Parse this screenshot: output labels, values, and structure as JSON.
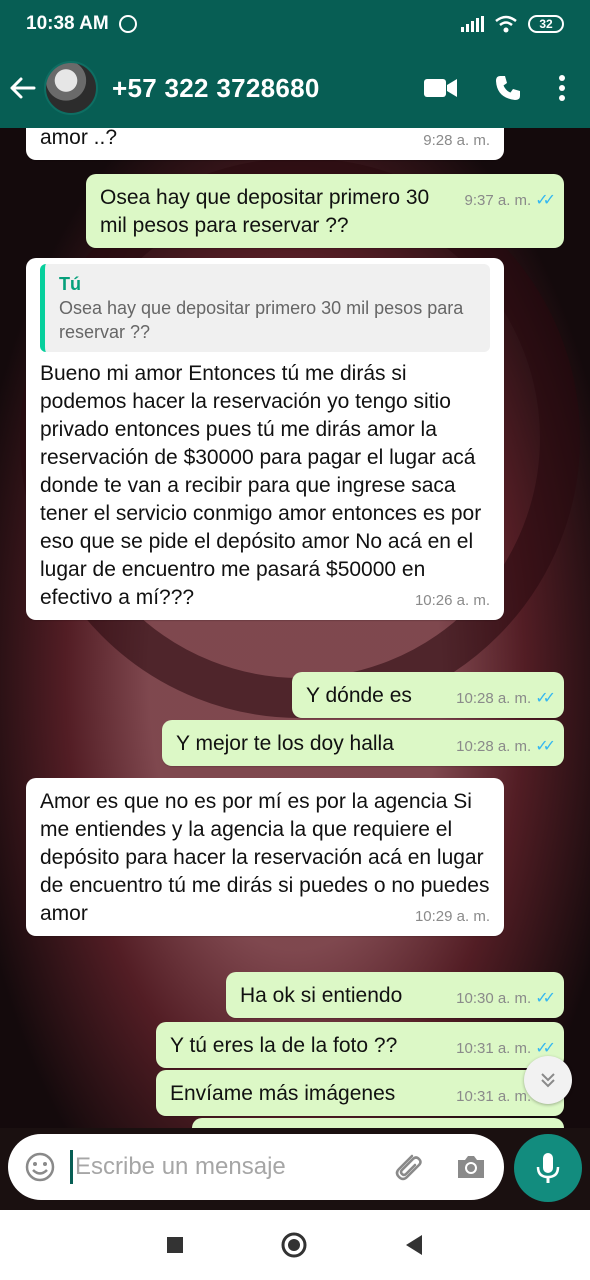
{
  "status": {
    "time": "10:38 AM",
    "battery": "32"
  },
  "header": {
    "contact": "+57 322 3728680"
  },
  "messages": [
    {
      "dir": "in",
      "text": "amor ..?",
      "time": "9:28 a. m."
    },
    {
      "dir": "out",
      "text": "Osea hay que depositar primero 30 mil pesos para reservar ??",
      "time": "9:37 a. m."
    },
    {
      "dir": "in",
      "quote_author": "Tú",
      "quote_text": "Osea hay que depositar primero 30 mil pesos para reservar ??",
      "text": "Bueno mi amor Entonces tú me dirás si podemos hacer la reservación yo tengo sitio privado entonces pues tú me dirás amor la reservación de $30000 para pagar el lugar acá donde te van a recibir para que ingrese saca tener el servicio conmigo amor entonces es por eso que se pide el depósito amor No acá en el lugar de encuentro me pasará $50000 en efectivo a mí???",
      "time": "10:26 a. m."
    },
    {
      "dir": "out",
      "text": "Y dónde es",
      "time": "10:28 a. m."
    },
    {
      "dir": "out",
      "text": "Y mejor te los doy halla",
      "time": "10:28 a. m."
    },
    {
      "dir": "in",
      "text": "Amor es que no es por mí es por la agencia Si me entiendes y la agencia la que requiere el depósito para hacer la reservación acá en lugar de encuentro tú me dirás si puedes o no puedes amor",
      "time": "10:29 a. m."
    },
    {
      "dir": "out",
      "text": "Ha ok si entiendo",
      "time": "10:30 a. m."
    },
    {
      "dir": "out",
      "text": "Y tú eres la de la foto ??",
      "time": "10:31 a. m."
    },
    {
      "dir": "out",
      "text": "Envíame más imágenes",
      "time": "10:31 a. m."
    }
  ],
  "input": {
    "placeholder": "Escribe un mensaje"
  },
  "icons": [
    "back-arrow",
    "video-call",
    "phone",
    "more-vert",
    "emoji",
    "attach-clip",
    "camera",
    "mic",
    "scroll-down",
    "nav-recents",
    "nav-home",
    "nav-back"
  ],
  "colors": {
    "header": "#075e54",
    "outgoing": "#dcf8c6",
    "incoming": "#ffffff",
    "ticks": "#34b7f1",
    "fab": "#128c7e"
  }
}
